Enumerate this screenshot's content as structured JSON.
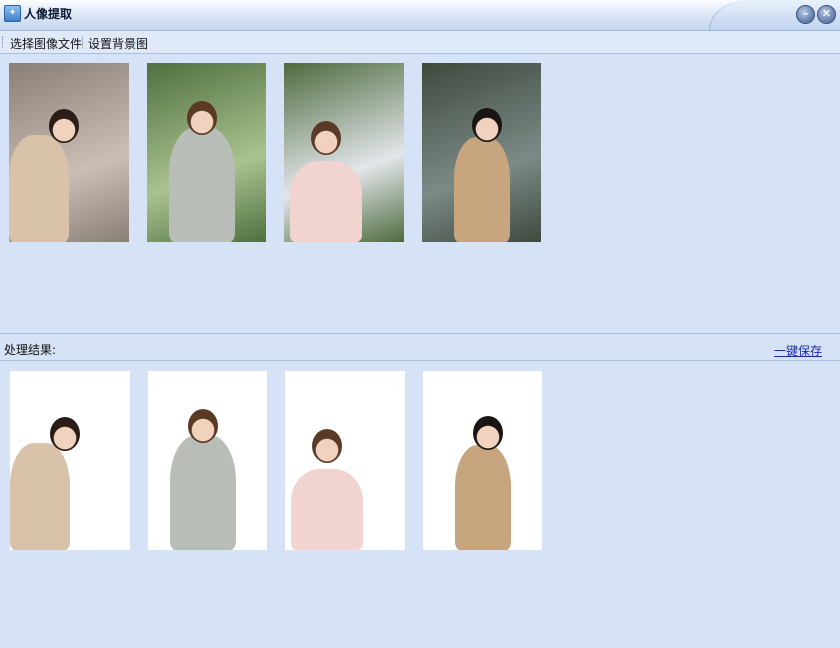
{
  "window": {
    "title": "人像提取",
    "icon": "app-logo-icon",
    "minimize_icon": "minimize-icon",
    "close_icon": "close-icon"
  },
  "toolbar": {
    "select_image": "选择图像文件",
    "set_background": "设置背景图"
  },
  "results": {
    "label": "处理结果:",
    "save_all": "一键保存"
  },
  "source_images": [
    {
      "id": 1,
      "bg": "#8a7f76",
      "bg2": "#c9bfb5",
      "hair": "#2b1c15",
      "cloth": "#d8c2aa"
    },
    {
      "id": 2,
      "bg": "#4f7040",
      "bg2": "#a9c38f",
      "hair": "#5a3a24",
      "cloth": "#b9bdb8"
    },
    {
      "id": 3,
      "bg": "#4e6b3e",
      "bg2": "#e2e6ea",
      "hair": "#5a3a26",
      "cloth": "#f1d4cf"
    },
    {
      "id": 4,
      "bg": "#3f4a3e",
      "bg2": "#7c8a86",
      "hair": "#1a1412",
      "cloth": "#c7a67f"
    }
  ],
  "result_images": [
    {
      "id": 1,
      "hair": "#2b1c15",
      "cloth": "#d8c2aa"
    },
    {
      "id": 2,
      "hair": "#5a3a24",
      "cloth": "#b9bdb8"
    },
    {
      "id": 3,
      "hair": "#5a3a26",
      "cloth": "#f1d4cf"
    },
    {
      "id": 4,
      "hair": "#1a1412",
      "cloth": "#c7a67f"
    }
  ]
}
